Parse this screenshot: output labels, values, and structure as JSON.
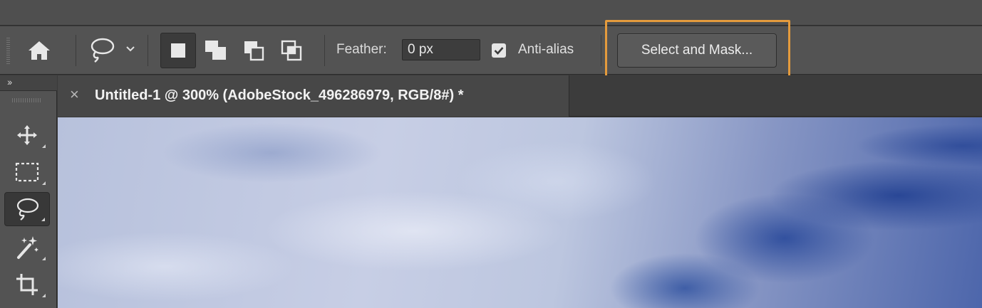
{
  "options_bar": {
    "feather_label": "Feather:",
    "feather_value": "0 px",
    "antialias_label": "Anti-alias",
    "antialias_checked": true,
    "select_and_mask_label": "Select and Mask...",
    "highlight_color": "#e49b3d"
  },
  "toolbar": {
    "collapse_glyph": "››",
    "tools": [
      {
        "name": "move",
        "icon": "move-icon"
      },
      {
        "name": "rectangular-marquee",
        "icon": "marquee-icon"
      },
      {
        "name": "lasso",
        "icon": "lasso-icon",
        "active": true
      },
      {
        "name": "magic-wand",
        "icon": "magic-wand-icon"
      },
      {
        "name": "crop",
        "icon": "crop-icon"
      }
    ]
  },
  "document": {
    "close_glyph": "×",
    "tab_title": "Untitled-1 @ 300% (AdobeStock_496286979, RGB/8#) *"
  }
}
